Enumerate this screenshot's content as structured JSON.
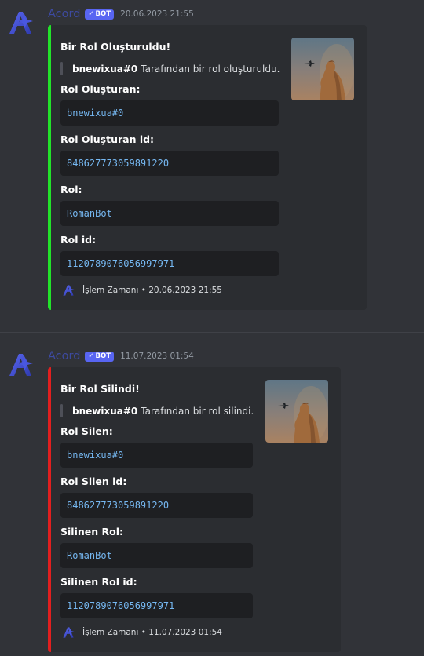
{
  "messages": [
    {
      "username": "Acord",
      "badge": "BOT",
      "timestamp": "20.06.2023 21:55",
      "embed": {
        "accent": "#22e32a",
        "title": "Bir Rol Oluşturuldu!",
        "quote_user": "bnewixua#0",
        "quote_text": "Tarafından bir rol oluşturuldu.",
        "fields": [
          {
            "label": "Rol Oluşturan:",
            "value": "bnewixua#0"
          },
          {
            "label": "Rol Oluşturan id:",
            "value": "848627773059891220"
          },
          {
            "label": "Rol:",
            "value": "RomanBot"
          },
          {
            "label": "Rol id:",
            "value": "1120789076056997971"
          }
        ],
        "footer": "İşlem Zamanı • 20.06.2023 21:55"
      }
    },
    {
      "username": "Acord",
      "badge": "BOT",
      "timestamp": "11.07.2023 01:54",
      "embed": {
        "accent": "#e21f1f",
        "title": "Bir Rol Silindi!",
        "quote_user": "bnewixua#0",
        "quote_text": "Tarafından bir rol silindi.",
        "fields": [
          {
            "label": "Rol Silen:",
            "value": "bnewixua#0"
          },
          {
            "label": "Rol Silen id:",
            "value": "848627773059891220"
          },
          {
            "label": "Silinen Rol:",
            "value": "RomanBot"
          },
          {
            "label": "Silinen Rol id:",
            "value": "1120789076056997971"
          }
        ],
        "footer": "İşlem Zamanı • 11.07.2023 01:54"
      }
    }
  ],
  "icons": {
    "avatar": "acord-logo-icon",
    "badge_check": "checkmark-icon",
    "footer": "acord-logo-icon",
    "thumbnail": "roman-statue-thumbnail"
  }
}
